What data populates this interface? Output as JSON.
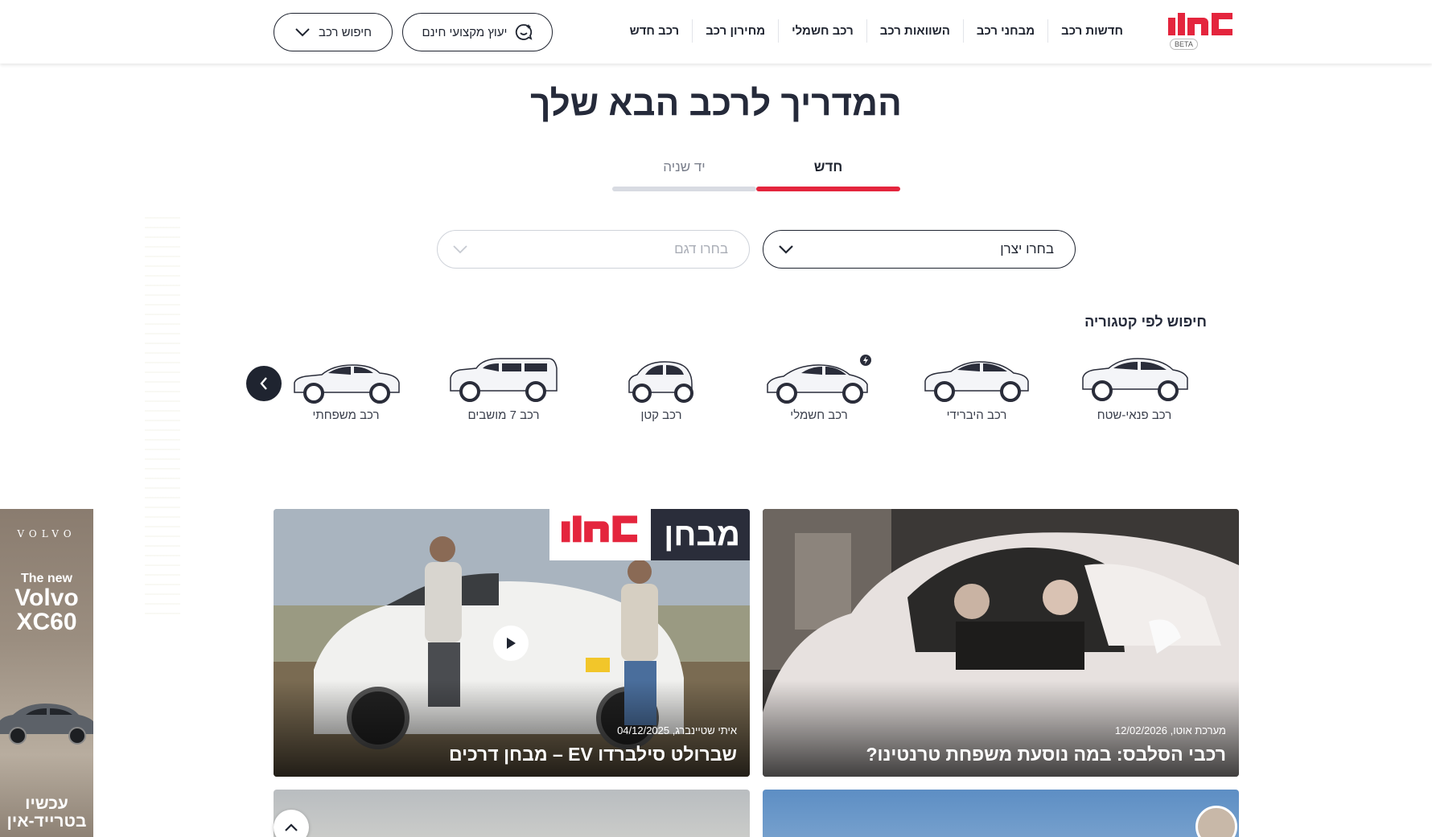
{
  "header": {
    "logo": "אוטו",
    "beta": "BETA",
    "nav": [
      "חדשות רכב",
      "מבחני רכב",
      "השוואות רכב",
      "רכב חשמלי",
      "מחירון רכב",
      "רכב חדש"
    ],
    "advisor_button": "יעוץ מקצועי חינם",
    "search_button": "חיפוש רכב"
  },
  "hero": {
    "title": "המדריך לרכב הבא שלך",
    "tabs": {
      "new": "חדש",
      "used": "יד שניה",
      "active": "new"
    },
    "maker_select": "בחרו יצרן",
    "model_select": "בחרו דגם"
  },
  "categories": {
    "title": "חיפוש לפי קטגוריה",
    "items": [
      "רכב פנאי-שטח",
      "רכב היברידי",
      "רכב חשמלי",
      "רכב קטן",
      "רכב 7 מושבים",
      "רכב משפחתי"
    ]
  },
  "ad": {
    "brand": "VOLVO",
    "tagline": "The new",
    "model": "Volvo XC60",
    "cta": "עכשיו בטרייד-אין"
  },
  "articles": [
    {
      "title": "רכבי הסלבס: במה נוסעת משפחת טרנטינו?",
      "author": "מערכת אוטו,",
      "date": "12/02/2026"
    },
    {
      "title": "שברולט סילברדו EV – מבחן דרכים",
      "author": "איתי שטיינברג,",
      "date": "04/12/2025",
      "badge_word": "מבחן",
      "badge_logo": "אוטו",
      "video": true
    }
  ],
  "colors": {
    "brand_red": "#e4253d",
    "dark": "#1f2430"
  }
}
